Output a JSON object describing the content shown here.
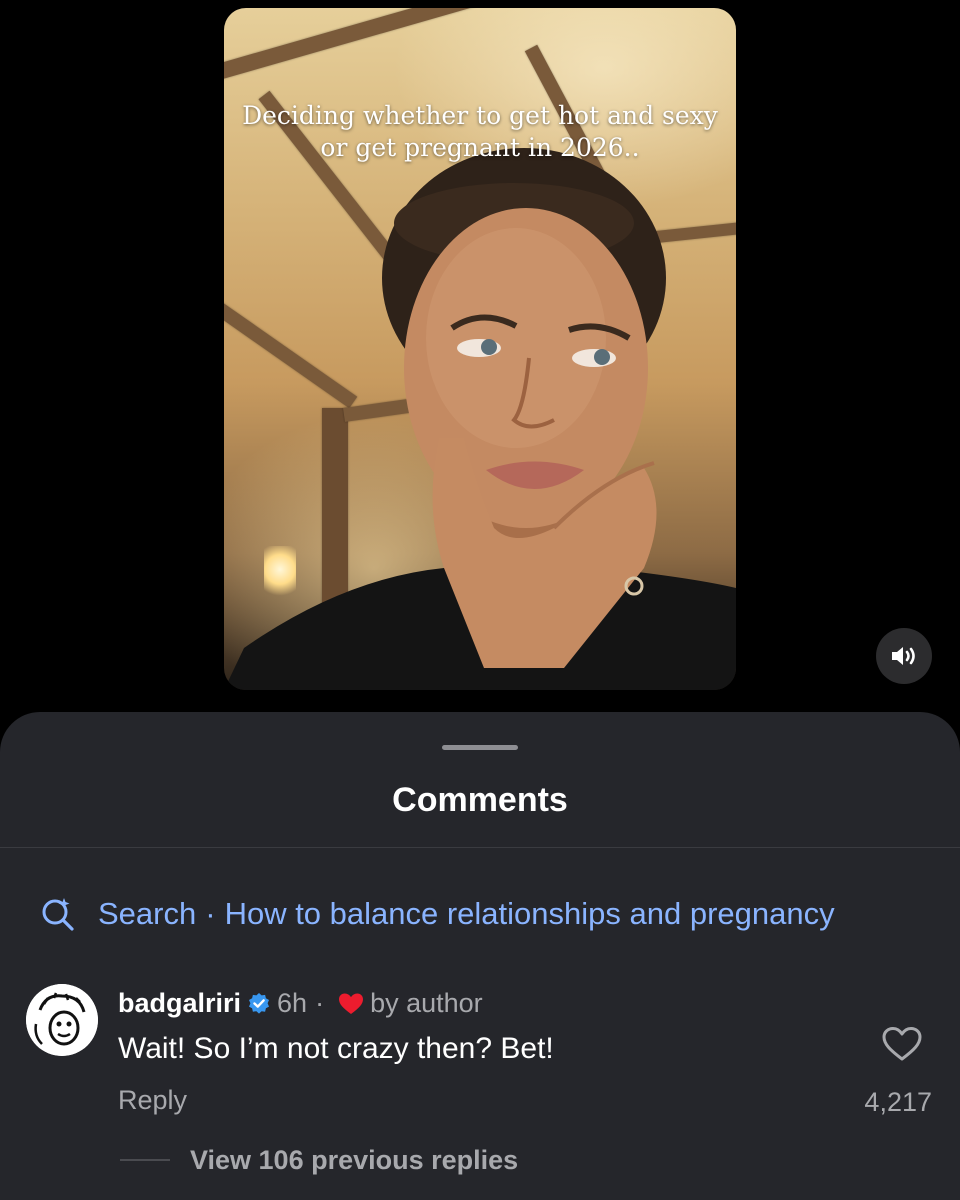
{
  "video": {
    "caption": "Deciding whether to get hot and sexy or get pregnant in 2026..",
    "sound_icon": "speaker-on-icon"
  },
  "comments_sheet": {
    "title": "Comments",
    "search": {
      "icon": "sparkle-search-icon",
      "label": "Search",
      "separator": "·",
      "suggestion": "How to balance relationships and pregnancy"
    },
    "comment": {
      "username": "badgalriri",
      "verified_icon": "verified-badge-icon",
      "time": "6h",
      "dot": "·",
      "liked_by_author_icon": "heart-filled-icon",
      "by_author": "by author",
      "text": "Wait! So I’m not crazy then? Bet!",
      "reply_label": "Reply",
      "like_icon": "heart-outline-icon",
      "like_count": "4,217"
    },
    "view_replies": "View 106 previous replies"
  },
  "colors": {
    "sheet_bg": "#25262b",
    "link_blue": "#8ab4ff",
    "muted_text": "#a8a9ad",
    "verified_blue": "#3897f0",
    "heart_red": "#ed1c2e"
  }
}
